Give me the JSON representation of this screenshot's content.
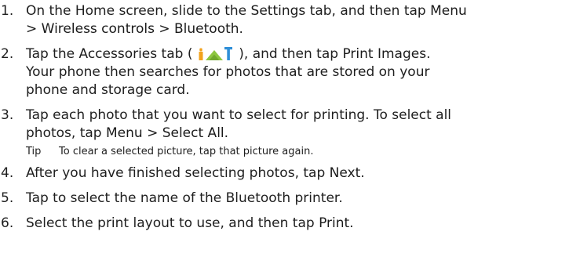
{
  "steps": [
    {
      "num": "1.",
      "lines": [
        [
          "On the Home screen, slide to the ",
          "Settings",
          " tab, and then tap ",
          "Menu"
        ],
        [
          "> Wireless controls > Bluetooth",
          "."
        ]
      ]
    },
    {
      "num": "2.",
      "lines": [
        [
          "Tap the ",
          "Accessories",
          " tab ( ",
          " ), and then tap ",
          "Print Images",
          "."
        ],
        [
          "Your phone then searches for photos that are stored on your"
        ],
        [
          "phone and storage card."
        ]
      ]
    },
    {
      "num": "3.",
      "lines": [
        [
          "Tap each photo that you want to select for printing. To select all"
        ],
        [
          "photos, tap ",
          "Menu > Select All",
          "."
        ]
      ]
    },
    {
      "num": "4.",
      "lines": [
        [
          "After you have finished selecting photos, tap ",
          "Next",
          "."
        ]
      ]
    },
    {
      "num": "5.",
      "lines": [
        [
          "Tap to select the name of the Bluetooth printer."
        ]
      ]
    },
    {
      "num": "6.",
      "lines": [
        [
          "Select the print layout to use, and then tap ",
          "Print",
          "."
        ]
      ]
    }
  ],
  "tip": {
    "label": "Tip",
    "text": "To clear a selected picture, tap that picture again."
  },
  "icons": {
    "accessories_tab": "accessories-tab-icon"
  },
  "colors": {
    "text": "#1e1e1e",
    "icon_orange": "#f2a21c",
    "icon_green": "#8dc63f",
    "icon_blue": "#2f8fd8"
  }
}
